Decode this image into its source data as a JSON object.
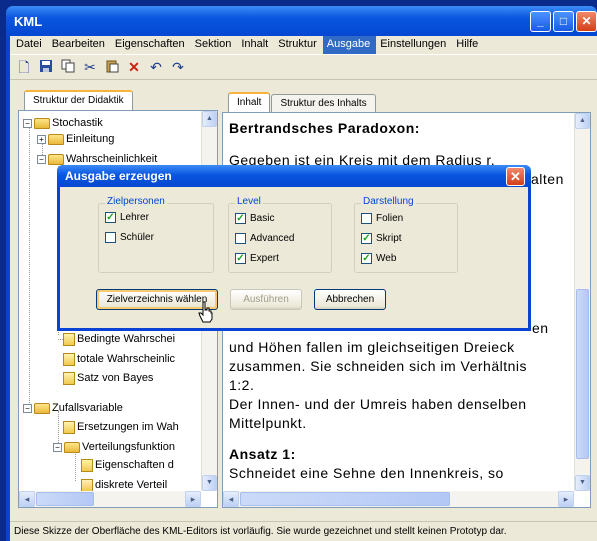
{
  "window": {
    "title": "KML"
  },
  "menubar": {
    "items": [
      "Datei",
      "Bearbeiten",
      "Eigenschaften",
      "Sektion",
      "Inhalt",
      "Struktur",
      "Ausgabe",
      "Einstellungen",
      "Hilfe"
    ],
    "active": "Ausgabe"
  },
  "toolbar": {
    "icons": [
      "new-document-icon",
      "save-icon",
      "copy-icon",
      "cut-icon",
      "paste-icon",
      "delete-icon",
      "undo-icon",
      "redo-icon"
    ]
  },
  "left_panel": {
    "tab": "Struktur der Didaktik",
    "tree": [
      {
        "label": "Stochastik",
        "type": "folder"
      },
      {
        "label": "Einleitung",
        "type": "folder"
      },
      {
        "label": "Wahrscheinlichkeit",
        "type": "folder"
      },
      {
        "label": "Bedingte Wahrschei",
        "type": "doc"
      },
      {
        "label": "totale Wahrscheinlic",
        "type": "doc"
      },
      {
        "label": "Satz von Bayes",
        "type": "doc"
      },
      {
        "label": "Zufallsvariable",
        "type": "folder"
      },
      {
        "label": "Ersetzungen im Wah",
        "type": "doc"
      },
      {
        "label": "Verteilungsfunktion",
        "type": "folder"
      },
      {
        "label": "Eigenschaften d",
        "type": "doc"
      },
      {
        "label": "diskrete Verteil",
        "type": "doc"
      }
    ]
  },
  "right_panel": {
    "tabs": [
      "Inhalt",
      "Struktur des Inhalts"
    ],
    "title": "Bertrandsches Paradoxon:",
    "line1": "Gegeben ist ein Kreis mit dem Radius r.",
    "line1_cut": "alten",
    "line_en": "en",
    "body_lines": [
      "und Höhen fallen im gleichseitigen Dreieck",
      "zusammen. Sie schneiden sich im Verhältnis",
      "1:2.",
      "Der Innen- und der Umreis haben denselben",
      "Mittelpunkt."
    ],
    "subtitle": "Ansatz 1:",
    "last_line": "Schneidet eine Sehne den Innenkreis, so"
  },
  "dialog": {
    "title": "Ausgabe erzeugen",
    "groups": {
      "zielpersonen": {
        "label": "Zielpersonen",
        "options": [
          {
            "label": "Lehrer",
            "checked": true
          },
          {
            "label": "Schüler",
            "checked": false
          }
        ]
      },
      "level": {
        "label": "Level",
        "options": [
          {
            "label": "Basic",
            "checked": true
          },
          {
            "label": "Advanced",
            "checked": false
          },
          {
            "label": "Expert",
            "checked": true
          }
        ]
      },
      "darstellung": {
        "label": "Darstellung",
        "options": [
          {
            "label": "Folien",
            "checked": false
          },
          {
            "label": "Skript",
            "checked": true
          },
          {
            "label": "Web",
            "checked": true
          }
        ]
      }
    },
    "buttons": {
      "target": "Zielverzeichnis wählen",
      "run": "Ausführen",
      "cancel": "Abbrechen"
    }
  },
  "statusbar": {
    "text": "Diese Skizze der Oberfläche des KML-Editors ist vorläufig. Sie wurde gezeichnet und stellt keinen Prototyp dar."
  },
  "colors": {
    "title_blue": "#0a56e0",
    "menu_highlight": "#316ac5",
    "dialog_close": "#d23f16",
    "group_label": "#0046d5"
  }
}
